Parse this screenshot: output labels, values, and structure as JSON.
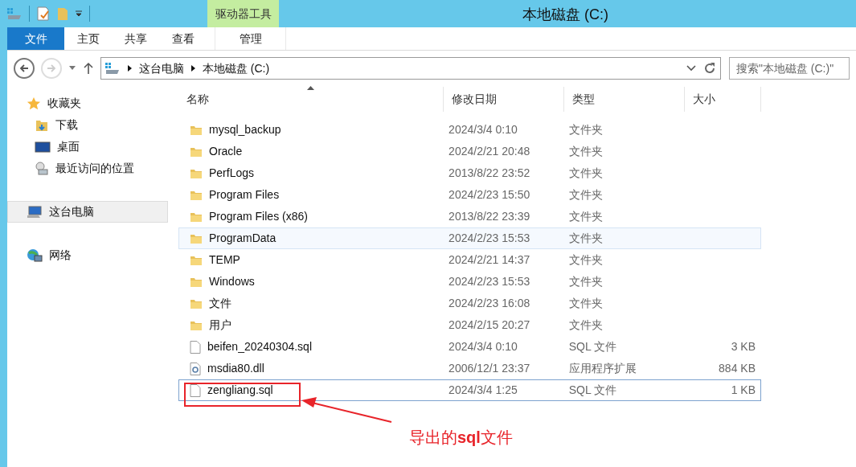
{
  "window": {
    "title": "本地磁盘 (C:)"
  },
  "ribbon": {
    "context_group": "驱动器工具",
    "tabs": [
      {
        "label": "文件",
        "selected": true,
        "kind": "file"
      },
      {
        "label": "主页",
        "selected": false,
        "kind": "tab"
      },
      {
        "label": "共享",
        "selected": false,
        "kind": "tab"
      },
      {
        "label": "查看",
        "selected": false,
        "kind": "tab"
      },
      {
        "label": "管理",
        "selected": false,
        "kind": "context"
      }
    ]
  },
  "address": {
    "crumbs": [
      "这台电脑",
      "本地磁盘 (C:)"
    ],
    "search_placeholder": "搜索\"本地磁盘 (C:)\""
  },
  "sidebar": {
    "items": [
      {
        "label": "收藏夹",
        "kind": "star",
        "selected": false,
        "children": [
          {
            "label": "下载",
            "kind": "download",
            "selected": false
          },
          {
            "label": "桌面",
            "kind": "desktop",
            "selected": false
          },
          {
            "label": "最近访问的位置",
            "kind": "recent",
            "selected": false
          }
        ]
      },
      {
        "label": "这台电脑",
        "kind": "computer",
        "selected": true
      },
      {
        "label": "网络",
        "kind": "network",
        "selected": false
      }
    ]
  },
  "table": {
    "columns": [
      "名称",
      "修改日期",
      "类型",
      "大小"
    ],
    "rows": [
      {
        "name": "mysql_backup",
        "date": "2024/3/4 0:10",
        "type": "文件夹",
        "kind": "folder",
        "selected": false,
        "hovered": false
      },
      {
        "name": "Oracle",
        "date": "2024/2/21 20:48",
        "type": "文件夹",
        "kind": "folder",
        "selected": false,
        "hovered": false
      },
      {
        "name": "PerfLogs",
        "date": "2013/8/22 23:52",
        "type": "文件夹",
        "kind": "folder",
        "selected": false,
        "hovered": false
      },
      {
        "name": "Program Files",
        "date": "2024/2/23 15:50",
        "type": "文件夹",
        "kind": "folder",
        "selected": false,
        "hovered": false
      },
      {
        "name": "Program Files (x86)",
        "date": "2013/8/22 23:39",
        "type": "文件夹",
        "kind": "folder",
        "selected": false,
        "hovered": false
      },
      {
        "name": "ProgramData",
        "date": "2024/2/23 15:53",
        "type": "文件夹",
        "kind": "folder",
        "selected": false,
        "hovered": true
      },
      {
        "name": "TEMP",
        "date": "2024/2/21 14:37",
        "type": "文件夹",
        "kind": "folder",
        "selected": false,
        "hovered": false
      },
      {
        "name": "Windows",
        "date": "2024/2/23 15:53",
        "type": "文件夹",
        "kind": "folder",
        "selected": false,
        "hovered": false
      },
      {
        "name": "文件",
        "date": "2024/2/23 16:08",
        "type": "文件夹",
        "kind": "folder",
        "selected": false,
        "hovered": false
      },
      {
        "name": "用户",
        "date": "2024/2/15 20:27",
        "type": "文件夹",
        "kind": "folder",
        "selected": false,
        "hovered": false
      },
      {
        "name": "beifen_20240304.sql",
        "date": "2024/3/4 0:10",
        "type": "SQL 文件",
        "size": "3 KB",
        "kind": "file",
        "selected": false,
        "hovered": false
      },
      {
        "name": "msdia80.dll",
        "date": "2006/12/1 23:37",
        "type": "应用程序扩展",
        "size": "884 KB",
        "kind": "dll",
        "selected": false,
        "hovered": false
      },
      {
        "name": "zengliang.sql",
        "date": "2024/3/4 1:25",
        "type": "SQL 文件",
        "size": "1 KB",
        "kind": "file",
        "selected": true,
        "hovered": false
      }
    ]
  },
  "annotation": {
    "label": "导出的**sql**文件"
  }
}
